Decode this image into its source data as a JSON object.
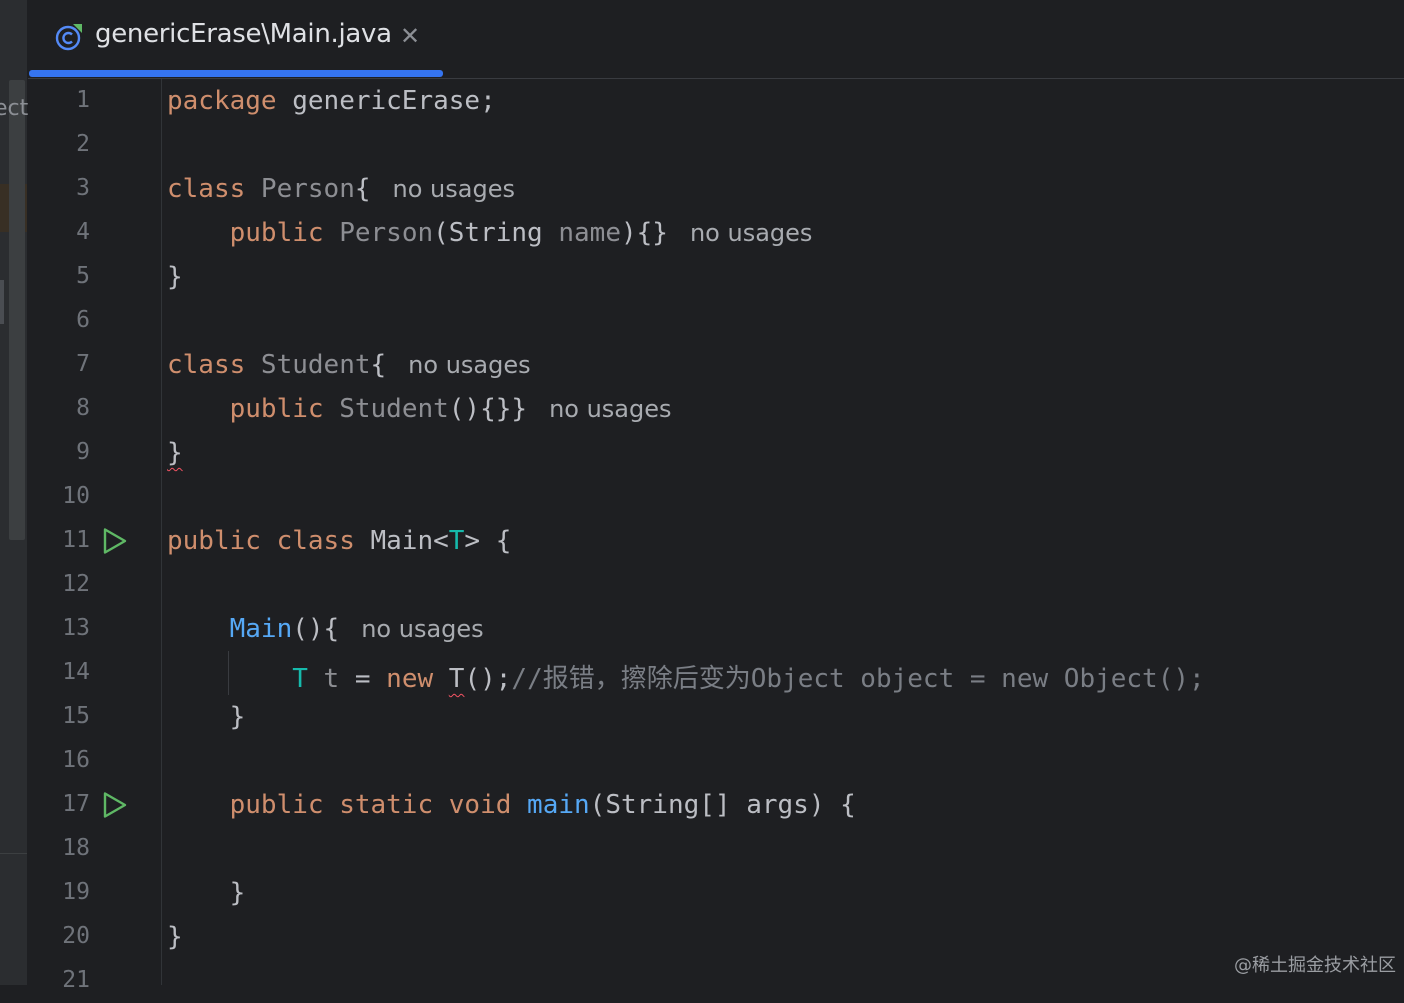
{
  "side_panel": {
    "partial_label": "ect"
  },
  "tab": {
    "icon": "java-class-icon",
    "title": "genericErase\\Main.java",
    "close_glyph": "✕"
  },
  "editor": {
    "lines": [
      {
        "n": "1"
      },
      {
        "n": "2"
      },
      {
        "n": "3"
      },
      {
        "n": "4"
      },
      {
        "n": "5"
      },
      {
        "n": "6"
      },
      {
        "n": "7"
      },
      {
        "n": "8"
      },
      {
        "n": "9"
      },
      {
        "n": "10"
      },
      {
        "n": "11",
        "run": true
      },
      {
        "n": "12"
      },
      {
        "n": "13"
      },
      {
        "n": "14"
      },
      {
        "n": "15"
      },
      {
        "n": "16"
      },
      {
        "n": "17",
        "run": true
      },
      {
        "n": "18"
      },
      {
        "n": "19"
      },
      {
        "n": "20"
      },
      {
        "n": "21"
      }
    ],
    "tokens": {
      "l1_kw": "package",
      "l1_rest": " genericErase;",
      "l3_kw": "class",
      "l3_name": " Person",
      "l3_brace": "{",
      "l3_hint": "no usages",
      "l4_indent": "    ",
      "l4_kw": "public",
      "l4_name": " Person",
      "l4_p1": "(String",
      "l4_param": " name",
      "l4_p2": "){}",
      "l4_hint": "no usages",
      "l5": "}",
      "l7_kw": "class",
      "l7_name": " Student",
      "l7_brace": "{",
      "l7_hint": "no usages",
      "l8_indent": "    ",
      "l8_kw": "public",
      "l8_name": " Student",
      "l8_p": "(){}}",
      "l8_hint": "no usages",
      "l9": "}",
      "l11_kw1": "public",
      "l11_kw2": " class",
      "l11_name": " Main<",
      "l11_tp": "T",
      "l11_end": "> {",
      "l13_indent": "    ",
      "l13_fn": "Main",
      "l13_p": "(){",
      "l13_hint": "no usages",
      "l14_indent": "        ",
      "l14_tp": "T",
      "l14_var": " t",
      "l14_eq": " = ",
      "l14_kw": "new",
      "l14_sp": " ",
      "l14_err": "T",
      "l14_p": "();",
      "l14_cm": "//报错，擦除后变为Object object = new Object();",
      "l15": "    }",
      "l17_indent": "    ",
      "l17_kw": "public static void",
      "l17_sp": " ",
      "l17_fn": "main",
      "l17_rest": "(String[] args) {",
      "l19": "    }",
      "l20": "}"
    }
  },
  "watermark": "@稀土掘金技术社区",
  "colors": {
    "background": "#1e1f22",
    "keyword": "#cf8e6d",
    "function": "#56a8f5",
    "type_param": "#16baac",
    "comment": "#7a7e85",
    "run_icon": "#5fb865",
    "tab_accent": "#3574f0"
  }
}
